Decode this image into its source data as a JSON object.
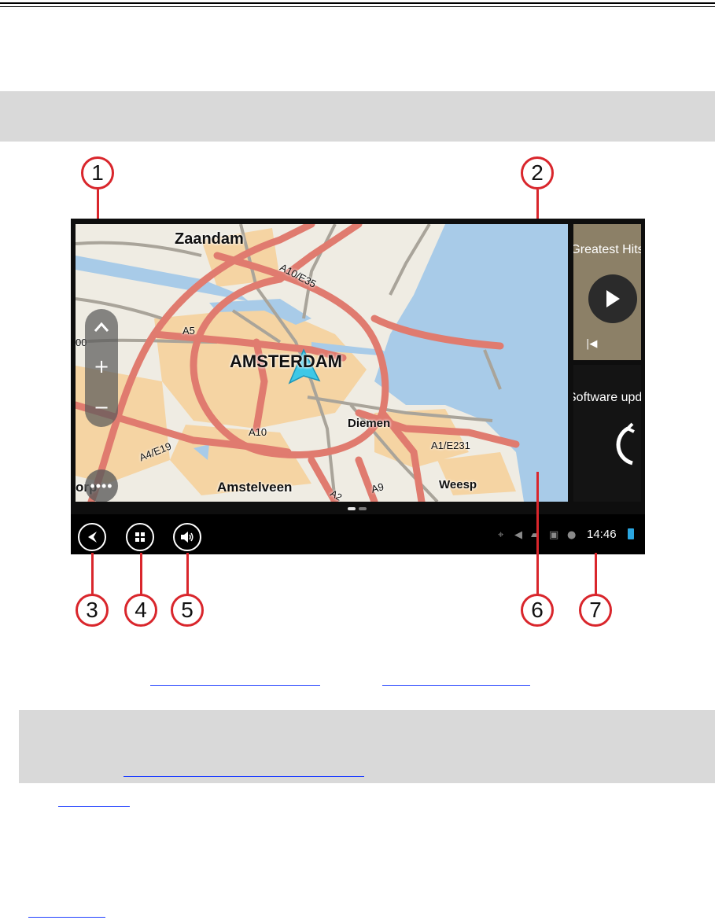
{
  "map": {
    "cities": [
      "Zaandam",
      "AMSTERDAM",
      "Diemen",
      "Amstelveen",
      "Weesp"
    ],
    "roads": [
      "A10/E35",
      "A5",
      "A10",
      "A4/E19",
      "A1/E231",
      "A9",
      "A2"
    ],
    "edge_labels": [
      "00",
      "orp"
    ]
  },
  "widgets": {
    "music_title": "Greatest Hits",
    "update_title": "Software update"
  },
  "status_bar": {
    "time": "14:46"
  },
  "callouts": [
    "1",
    "2",
    "3",
    "4",
    "5",
    "6",
    "7"
  ],
  "colors": {
    "callout_red": "#d9262c",
    "route_red": "#e07b6f",
    "land": "#efece3",
    "urban": "#f5d4a3",
    "water": "#a8cbe8",
    "cursor": "#3ec8e6",
    "music_tile": "#8c8067",
    "update_arrow_cyan": "#36c3e8",
    "link_blue": "#1f3fff",
    "gray_band": "#d9d9d9"
  }
}
